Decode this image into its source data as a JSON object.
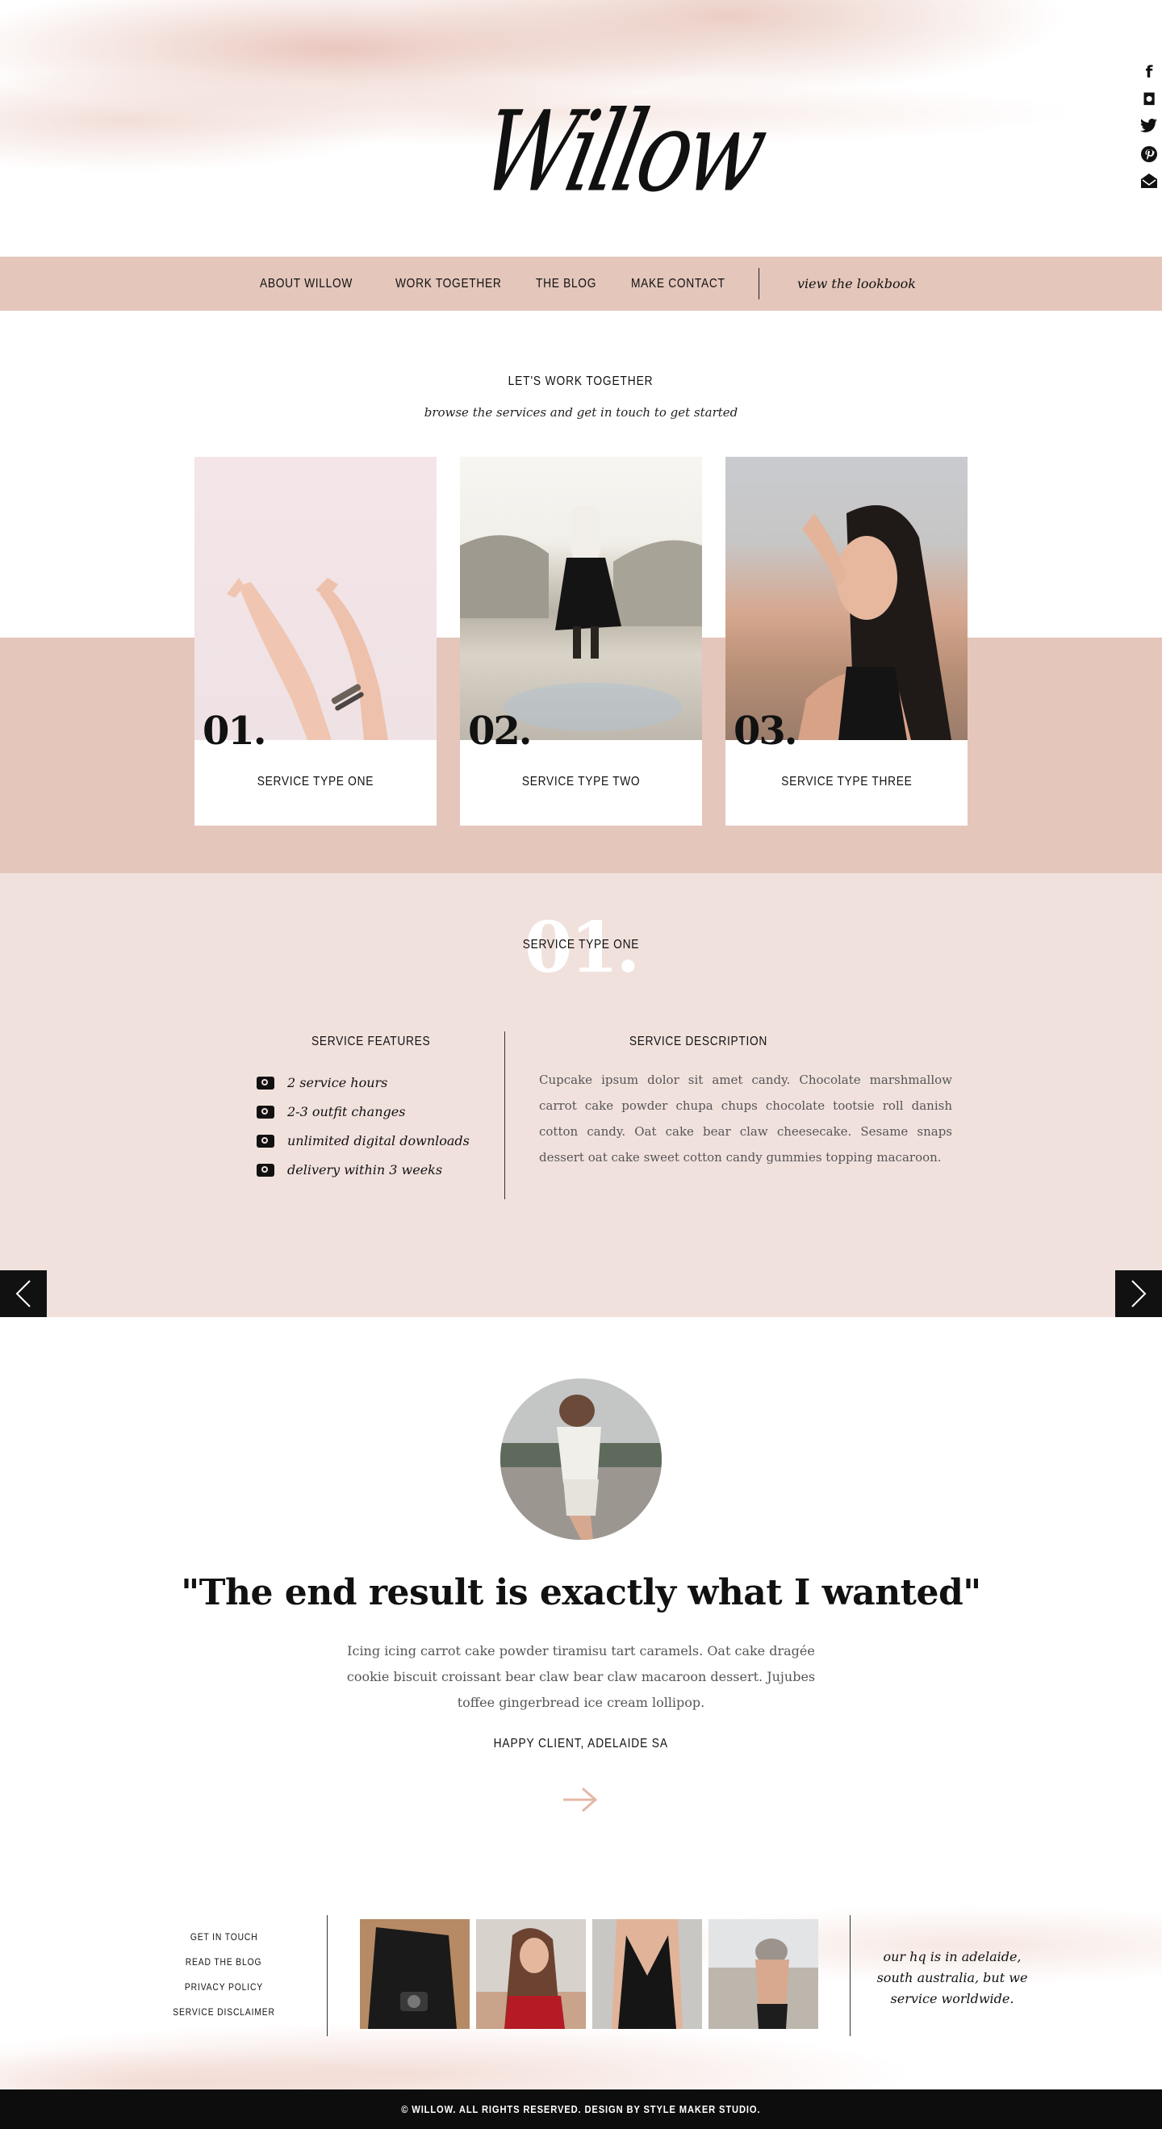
{
  "brand": {
    "logo": "Willow"
  },
  "social": [
    {
      "icon": "facebook-icon",
      "glyph": "f"
    },
    {
      "icon": "instagram-icon",
      "glyph": "◘"
    },
    {
      "icon": "twitter-icon",
      "glyph": "🐦"
    },
    {
      "icon": "pinterest-icon",
      "glyph": "℗"
    },
    {
      "icon": "email-icon",
      "glyph": "✉"
    }
  ],
  "nav": {
    "items": [
      "ABOUT WILLOW",
      "WORK TOGETHER",
      "THE BLOG",
      "MAKE CONTACT"
    ],
    "lookbook": "view the lookbook"
  },
  "intro": {
    "title": "LET'S WORK TOGETHER",
    "subtitle": "browse the services and get in touch to get started"
  },
  "cards": [
    {
      "num": "01.",
      "label": "SERVICE TYPE ONE"
    },
    {
      "num": "02.",
      "label": "SERVICE TYPE TWO"
    },
    {
      "num": "03.",
      "label": "SERVICE TYPE THREE"
    }
  ],
  "detail": {
    "bignum": "01.",
    "heading": "SERVICE TYPE ONE",
    "features_title": "SERVICE FEATURES",
    "features": [
      "2 service hours",
      "2-3 outfit changes",
      "unlimited digital downloads",
      "delivery within 3 weeks"
    ],
    "description_title": "SERVICE DESCRIPTION",
    "description": "Cupcake ipsum dolor sit amet candy. Chocolate marshmallow carrot cake powder chupa chups chocolate tootsie roll danish cotton candy. Oat cake bear claw cheesecake. Sesame snaps dessert oat cake sweet cotton candy gummies topping macaroon."
  },
  "testimonial": {
    "quote": "\"The end result is exactly what I wanted\"",
    "body": "Icing icing carrot cake powder tiramisu tart caramels. Oat cake dragée cookie biscuit croissant bear claw bear claw macaroon dessert. Jujubes toffee gingerbread ice cream lollipop.",
    "client": "HAPPY CLIENT, ADELAIDE SA"
  },
  "footer": {
    "links": [
      "GET IN TOUCH",
      "READ THE BLOG",
      "PRIVACY POLICY",
      "SERVICE DISCLAIMER"
    ],
    "hq": "our hq is in adelaide, south australia, but we service worldwide.",
    "copyright": "© WILLOW. ALL RIGHTS RESERVED. DESIGN BY STYLE MAKER STUDIO."
  },
  "colors": {
    "accent": "#e4c6bb",
    "light_accent": "#f1e1dd",
    "dark": "#111111"
  }
}
